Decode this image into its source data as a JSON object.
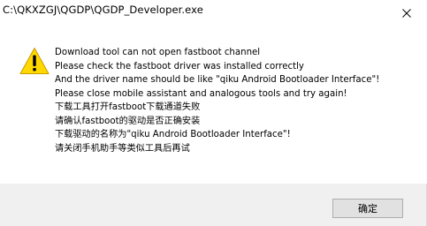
{
  "window": {
    "title": "C:\\QKXZGJ\\QGDP\\QGDP_Developer.exe"
  },
  "icons": {
    "close": "close-icon",
    "warning": "warning-icon"
  },
  "message": {
    "lines": [
      "Download tool can not open fastboot channel",
      "Please check the fastboot driver was installed correctly",
      "And the driver name should be like \"qiku Android Bootloader Interface\"!",
      "Please close mobile assistant and analogous tools and try again!",
      "下载工具打开fastboot下载通道失败",
      "请确认fastboot的驱动是否正确安装",
      "下载驱动的名称为\"qiku Android Bootloader Interface\"!",
      "请关闭手机助手等类似工具后再试"
    ]
  },
  "buttons": {
    "ok_label": "确定"
  },
  "colors": {
    "warning_fill": "#ffd800",
    "footer_bg": "#f0f0f0",
    "button_bg": "#e1e1e1",
    "button_border": "#adadad"
  }
}
